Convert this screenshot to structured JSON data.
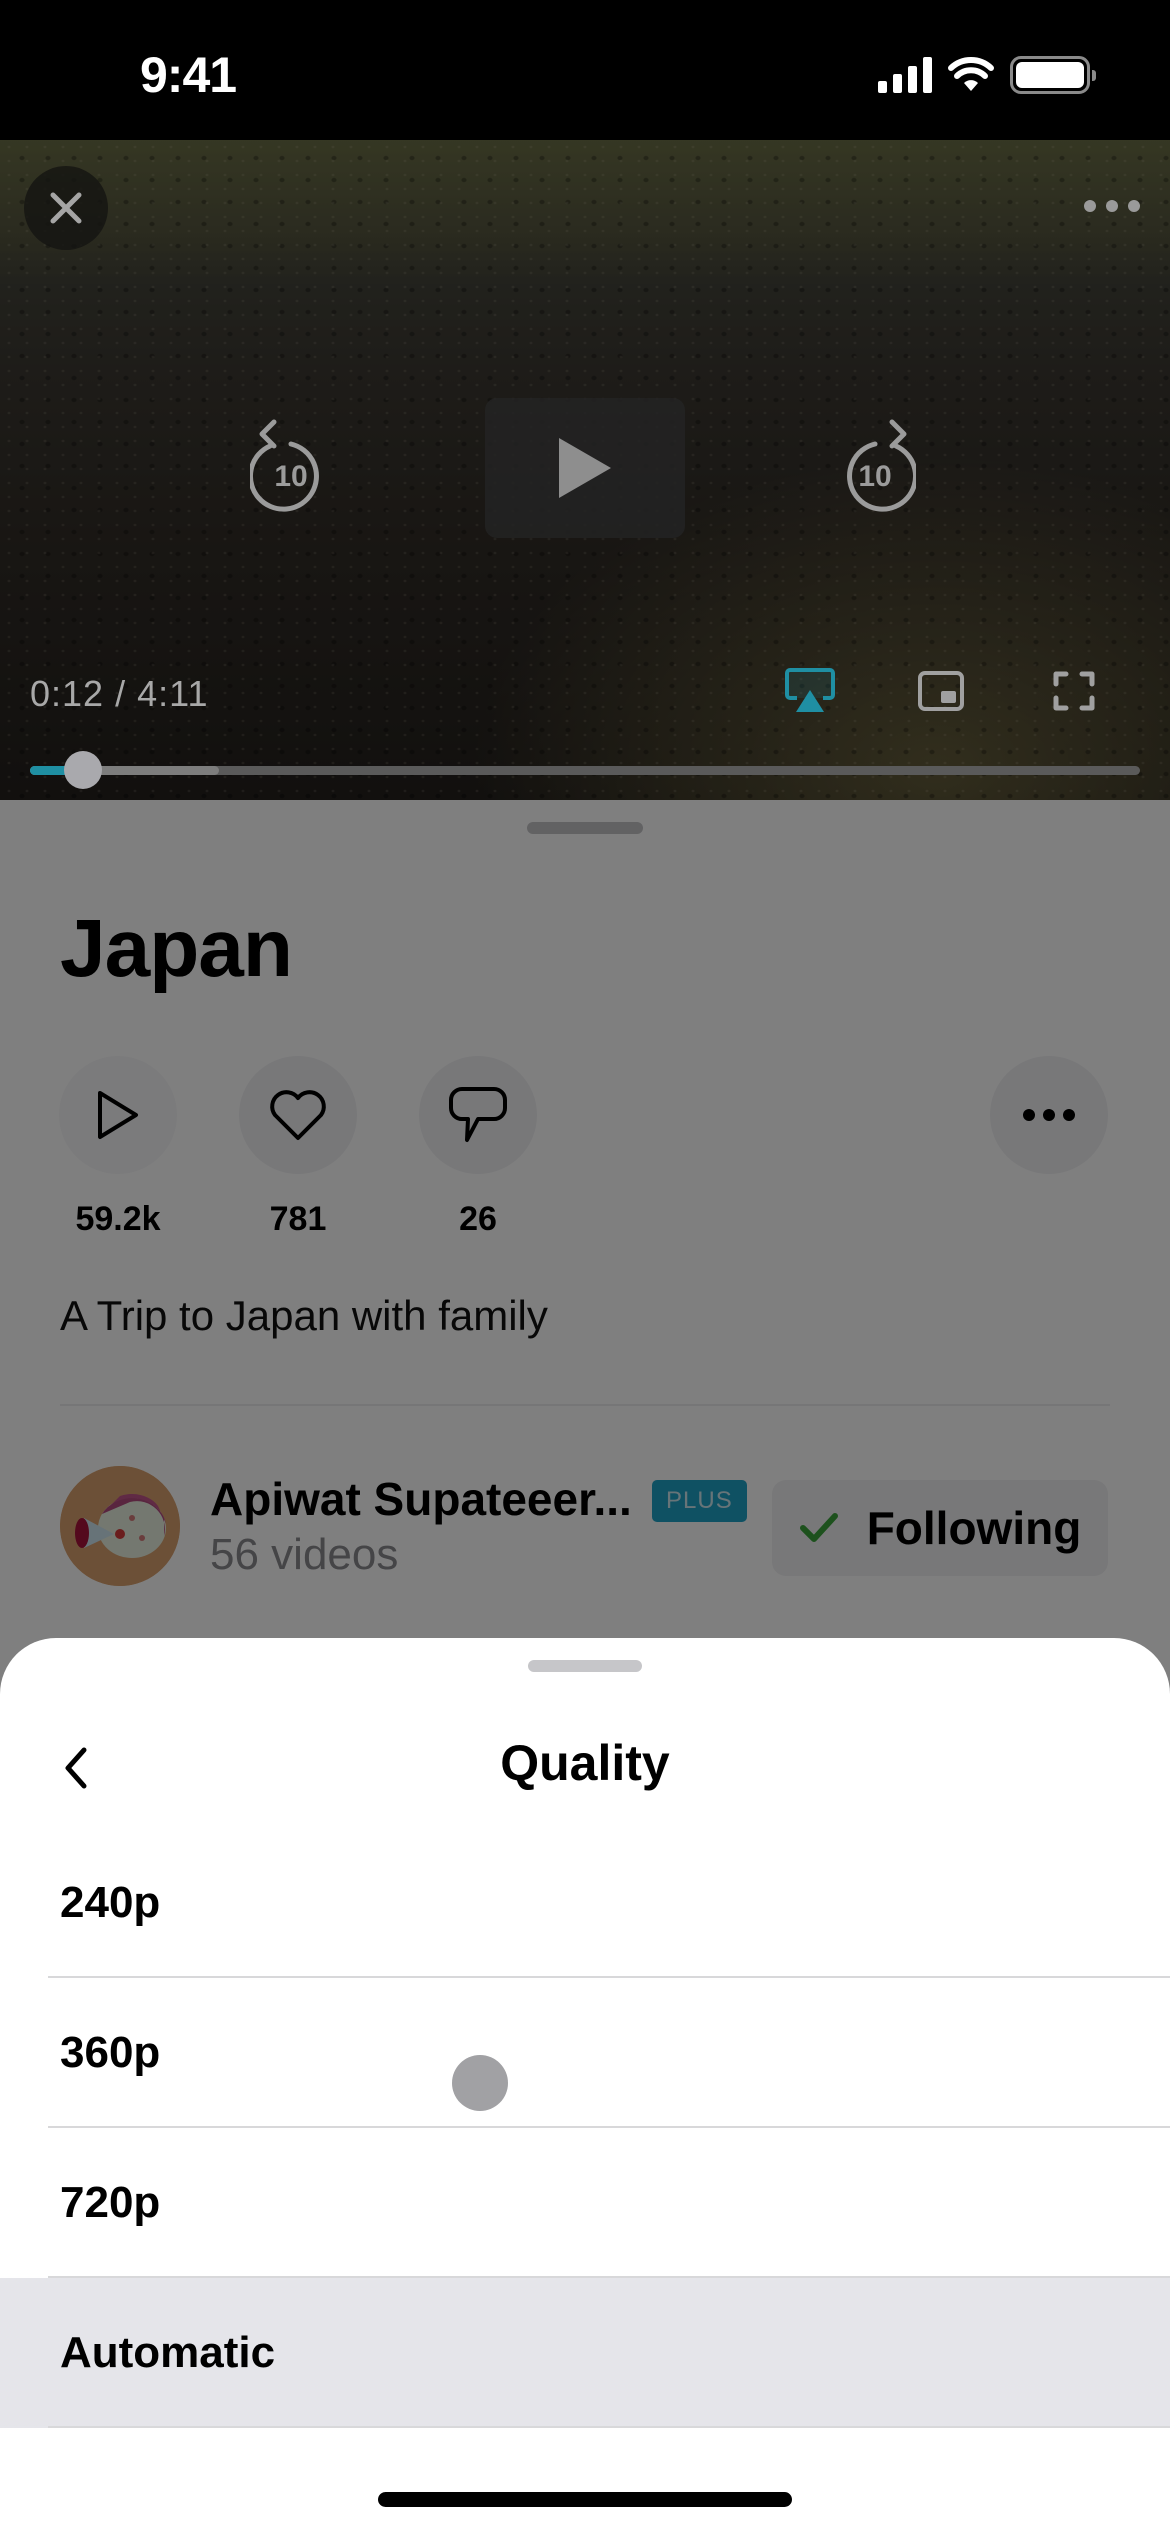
{
  "status_bar": {
    "time": "9:41",
    "icons": [
      "cellular-signal-icon",
      "wifi-icon",
      "battery-icon"
    ]
  },
  "player": {
    "close_icon": "close-icon",
    "more_icon": "more-horizontal-icon",
    "skip_back": {
      "icon": "rewind-10-icon",
      "seconds": "10"
    },
    "skip_forward": {
      "icon": "forward-10-icon",
      "seconds": "10"
    },
    "play_icon": "play-icon",
    "current_time": "0:12",
    "duration": "4:11",
    "time_readout": "0:12 / 4:11",
    "airplay_icon": "airplay-icon",
    "pip_icon": "picture-in-picture-icon",
    "fullscreen_icon": "fullscreen-icon",
    "progress_played_fraction": 0.048,
    "progress_buffered_fraction": 0.17,
    "accent_color": "#1f8fa3"
  },
  "details": {
    "title": "Japan",
    "stats": [
      {
        "icon": "play-outline-icon",
        "count": "59.2k"
      },
      {
        "icon": "heart-outline-icon",
        "count": "781"
      },
      {
        "icon": "comment-bubble-icon",
        "count": "26"
      }
    ],
    "more_icon": "more-horizontal-icon",
    "description": "A Trip to Japan with family",
    "channel": {
      "name": "Apiwat Supateeer...",
      "badge": "PLUS",
      "badge_color": "#1ea2c7",
      "video_count": "56 videos",
      "follow_label": "Following",
      "follow_check_color": "#3aa33a"
    }
  },
  "quality_sheet": {
    "title": "Quality",
    "back_icon": "chevron-left-icon",
    "options": [
      {
        "label": "240p",
        "selected": false
      },
      {
        "label": "360p",
        "selected": false
      },
      {
        "label": "720p",
        "selected": false
      },
      {
        "label": "Automatic",
        "selected": true
      }
    ]
  }
}
